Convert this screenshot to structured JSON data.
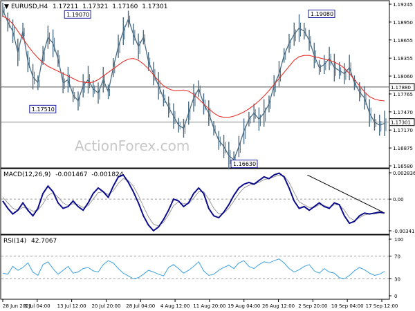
{
  "chart_data": [
    {
      "type": "line",
      "name": "main",
      "header": {
        "symbol": "EURUSD,H4",
        "open": "1.17211",
        "high": "1.17321",
        "low": "1.17160",
        "close": "1.17301"
      },
      "y_ticks": [
        "1.19245",
        "1.18950",
        "1.18655",
        "1.18355",
        "1.18060",
        "1.17765",
        "1.17470",
        "1.17170",
        "1.16875",
        "1.16580"
      ],
      "ylim": [
        1.1658,
        1.19245
      ],
      "horizontal_lines": [
        {
          "value": 1.1788,
          "label": "1.17880"
        },
        {
          "value": 1.17301,
          "label": "1.17301"
        }
      ],
      "annotations": [
        {
          "text": "1.19070",
          "value": 1.1907,
          "x_frac": 0.17
        },
        {
          "text": "1.17510",
          "value": 1.1751,
          "x_frac": 0.08
        },
        {
          "text": "1.16630",
          "value": 1.1663,
          "x_frac": 0.6
        },
        {
          "text": "1.19080",
          "value": 1.1908,
          "x_frac": 0.8
        }
      ],
      "series": [
        {
          "name": "price",
          "values": [
            1.1915,
            1.1895,
            1.188,
            1.1845,
            1.188,
            1.183,
            1.1805,
            1.1795,
            1.184,
            1.187,
            1.186,
            1.1835,
            1.1795,
            1.18,
            1.1775,
            1.1765,
            1.179,
            1.18,
            1.1785,
            1.1778,
            1.18,
            1.178,
            1.182,
            1.1855,
            1.188,
            1.19,
            1.1875,
            1.1855,
            1.187,
            1.183,
            1.181,
            1.179,
            1.177,
            1.1755,
            1.174,
            1.1725,
            1.172,
            1.1745,
            1.177,
            1.1785,
            1.176,
            1.1745,
            1.172,
            1.17,
            1.169,
            1.1675,
            1.1668,
            1.169,
            1.1715,
            1.1735,
            1.1745,
            1.1735,
            1.1745,
            1.176,
            1.179,
            1.181,
            1.184,
            1.186,
            1.1875,
            1.1885,
            1.188,
            1.1865,
            1.184,
            1.182,
            1.1825,
            1.1835,
            1.182,
            1.1815,
            1.181,
            1.182,
            1.1795,
            1.178,
            1.177,
            1.1745,
            1.173,
            1.1725,
            1.1728
          ]
        },
        {
          "name": "moving-average",
          "values": [
            1.1905,
            1.19,
            1.1892,
            1.188,
            1.1868,
            1.1856,
            1.1845,
            1.1836,
            1.1828,
            1.1822,
            1.1818,
            1.1814,
            1.181,
            1.1806,
            1.1802,
            1.1798,
            1.1796,
            1.1795,
            1.1796,
            1.18,
            1.1806,
            1.1812,
            1.1818,
            1.1824,
            1.183,
            1.1834,
            1.1835,
            1.1832,
            1.1826,
            1.1818,
            1.1808,
            1.1798,
            1.179,
            1.1785,
            1.1782,
            1.1782,
            1.1783,
            1.1781,
            1.1776,
            1.1768,
            1.176,
            1.1752,
            1.1745,
            1.174,
            1.1738,
            1.1738,
            1.174,
            1.1743,
            1.1747,
            1.1752,
            1.1758,
            1.1765,
            1.1773,
            1.1782,
            1.1792,
            1.1802,
            1.1812,
            1.1822,
            1.1832,
            1.1838,
            1.184,
            1.184,
            1.1838,
            1.1836,
            1.1834,
            1.1832,
            1.1829,
            1.1825,
            1.1819,
            1.181,
            1.18,
            1.179,
            1.178,
            1.1772,
            1.1768,
            1.1766,
            1.1765
          ]
        }
      ],
      "watermark": "ActionForex.com"
    },
    {
      "type": "line",
      "name": "macd",
      "header": {
        "label": "MACD(12,26,9)",
        "macd": "-0.001467",
        "signal": "-0.001824"
      },
      "y_ticks": [
        "0.002836",
        "0.00",
        "-0.003415"
      ],
      "ylim": [
        -0.003415,
        0.002836
      ],
      "series": [
        {
          "name": "macd",
          "values": [
            -0.0002,
            -0.001,
            -0.0016,
            -0.0012,
            -0.0004,
            -0.0012,
            -0.0018,
            -0.001,
            0.0006,
            0.0014,
            0.0008,
            -0.0004,
            -0.001,
            -0.0008,
            -0.0002,
            -0.0008,
            -0.0012,
            -0.0004,
            0.0006,
            0.0012,
            0.0008,
            0.0002,
            0.0014,
            0.0024,
            0.0026,
            0.0018,
            0.0008,
            -0.0004,
            -0.0018,
            -0.0028,
            -0.0034,
            -0.003,
            -0.0022,
            -0.0012,
            0.0,
            -0.0002,
            -0.0008,
            -0.0004,
            0.0006,
            0.0012,
            0.0006,
            -0.001,
            -0.0018,
            -0.002,
            -0.0014,
            -0.0006,
            0.0004,
            0.0012,
            0.0016,
            0.0018,
            0.0016,
            0.002,
            0.0024,
            0.0022,
            0.0026,
            0.0028,
            0.0024,
            0.0012,
            -0.0002,
            -0.001,
            -0.0008,
            -0.0012,
            -0.0008,
            -0.0004,
            -0.0008,
            -0.001,
            -0.0004,
            -0.0006,
            -0.0018,
            -0.0026,
            -0.0024,
            -0.0018,
            -0.0015,
            -0.0016,
            -0.0015,
            -0.0014,
            -0.0015
          ]
        },
        {
          "name": "signal",
          "values": [
            0.0002,
            -0.0004,
            -0.001,
            -0.0012,
            -0.0009,
            -0.001,
            -0.0013,
            -0.0012,
            -0.0005,
            0.0004,
            0.0007,
            0.0002,
            -0.0004,
            -0.0007,
            -0.0005,
            -0.0006,
            -0.0009,
            -0.0007,
            0.0,
            0.0007,
            0.0008,
            0.0005,
            0.0009,
            0.0017,
            0.0022,
            0.002,
            0.0014,
            0.0004,
            -0.0008,
            -0.0019,
            -0.0027,
            -0.0029,
            -0.0025,
            -0.0017,
            -0.0007,
            -0.0003,
            -0.0005,
            -0.0005,
            0.0001,
            0.0008,
            0.0008,
            0.0,
            -0.001,
            -0.0016,
            -0.0015,
            -0.001,
            -0.0002,
            0.0006,
            0.0012,
            0.0015,
            0.0016,
            0.0018,
            0.0021,
            0.0022,
            0.0024,
            0.0026,
            0.0025,
            0.0018,
            0.0007,
            -0.0003,
            -0.0006,
            -0.0009,
            -0.0009,
            -0.0006,
            -0.0007,
            -0.0009,
            -0.0006,
            -0.0006,
            -0.0012,
            -0.002,
            -0.0023,
            -0.002,
            -0.0017,
            -0.0016,
            -0.0016,
            -0.0015,
            -0.0015
          ]
        }
      ],
      "trendline": [
        {
          "x_frac": 0.79,
          "value": 0.0026
        },
        {
          "x_frac": 0.985,
          "value": -0.0014
        }
      ]
    },
    {
      "type": "line",
      "name": "rsi",
      "header": {
        "label": "RSI(14)",
        "value": "42.7067"
      },
      "y_ticks": [
        "100",
        "70",
        "30",
        "0"
      ],
      "ylim": [
        0,
        100
      ],
      "levels": [
        70,
        30
      ],
      "series": [
        {
          "name": "rsi",
          "values": [
            40,
            38,
            52,
            45,
            50,
            58,
            42,
            36,
            55,
            60,
            48,
            38,
            45,
            52,
            40,
            42,
            48,
            50,
            44,
            42,
            55,
            62,
            58,
            48,
            40,
            35,
            30,
            32,
            38,
            45,
            42,
            38,
            35,
            50,
            55,
            48,
            40,
            45,
            52,
            60,
            44,
            36,
            38,
            45,
            50,
            54,
            48,
            58,
            62,
            52,
            48,
            55,
            60,
            58,
            62,
            65,
            58,
            48,
            42,
            46,
            52,
            55,
            44,
            40,
            48,
            42,
            40,
            32,
            30,
            36,
            44,
            50,
            46,
            40,
            36,
            38,
            43
          ]
        }
      ]
    }
  ],
  "x_axis": {
    "labels": [
      "28 Jun 2021",
      "6 Jul 04:00",
      "13 Jul 12:00",
      "20 Jul 20:00",
      "28 Jul 04:00",
      "4 Aug 12:00",
      "11 Aug 20:00",
      "19 Aug 04:00",
      "26 Aug 12:00",
      "2 Sep 20:00",
      "10 Sep 04:00",
      "17 Sep 12:00"
    ]
  },
  "colors": {
    "price": "#4a6b82",
    "moving_average": "#e8322c",
    "macd": "#0b0b8c",
    "signal": "#9a9a9a",
    "rsi": "#3aa0e0",
    "grid_dash": "#9a9a9a",
    "tag_border": "#1a1aa0"
  }
}
